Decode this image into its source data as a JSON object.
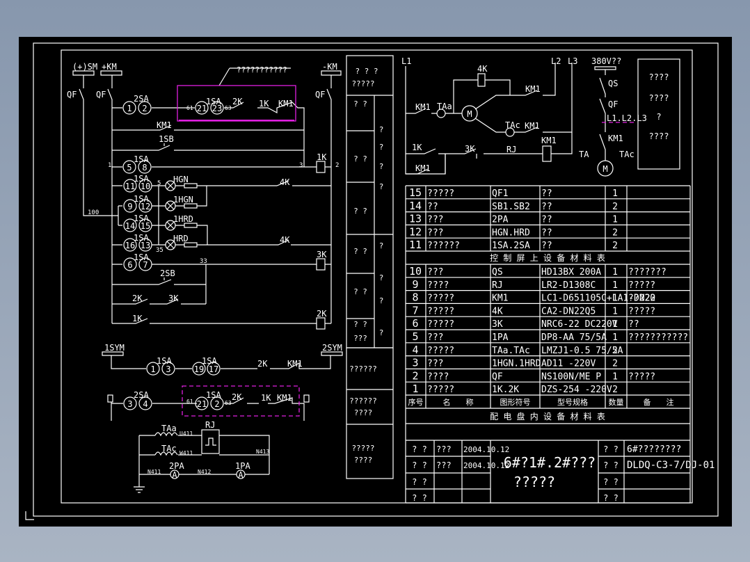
{
  "control": {
    "bus_pos": "(+)SM",
    "bus_km": "+KM",
    "bus_neg": "-KM",
    "qf": "QF",
    "note": "???????????",
    "sa1": "1SA",
    "sa2": "2SA",
    "k1": "1K",
    "k2": "2K",
    "k3": "3K",
    "k4": "4K",
    "km1": "KM1",
    "sb1": "1SB",
    "sb2": "2SB",
    "hgn": "HGN",
    "hgn1": "1HGN",
    "hrd1": "1HRD",
    "hrd": "HRD",
    "n1": "1",
    "n2": "2",
    "n3": "3",
    "n5": "5",
    "n35": "35",
    "n33": "33",
    "n100": "100",
    "n61": "61",
    "n63": "63",
    "terminals": [
      "1",
      "2",
      "21",
      "23",
      "5",
      "8",
      "11",
      "10",
      "9",
      "12",
      "14",
      "15",
      "16",
      "13",
      "6",
      "7"
    ]
  },
  "signal": {
    "sym1": "1SYM",
    "sym2": "2SYM",
    "terminals": [
      "1",
      "3",
      "19",
      "17",
      "3",
      "4",
      "21",
      "2"
    ],
    "taa": "TAa",
    "tac": "TAc",
    "rj": "RJ",
    "pa1": "1PA",
    "pa2": "2PA",
    "u411": "U411",
    "w411": "W411",
    "n411": "N411",
    "n412": "N412",
    "n413": "N413",
    "ammeter": "A"
  },
  "motor": {
    "l1": "L1",
    "l2": "L2",
    "l3": "L3",
    "km1": "KM1",
    "taa": "TAa",
    "tac": "TAc",
    "k4": "4K",
    "k1": "1K",
    "k3": "3K",
    "rj": "RJ",
    "motor": "M",
    "supply": "380V??",
    "qs": "QS",
    "qf": "QF",
    "phases": "L1.L2.L3",
    "ta": "TA",
    "legend": [
      "????",
      "????",
      "?",
      "????"
    ]
  },
  "side_column": {
    "header": [
      "? ? ?",
      "?????"
    ],
    "cells": [
      "? ?",
      "? ?",
      "? ?",
      "? ?",
      "? ?",
      "? ?",
      "? ?",
      "???"
    ],
    "right": [
      "?",
      "?",
      "?",
      "?",
      "?",
      "?",
      "?",
      "?"
    ],
    "lower": [
      "??????",
      "??????",
      "????",
      "?????",
      "????"
    ]
  },
  "control_table": {
    "rows": [
      [
        "15",
        "?????",
        "QF1",
        "??",
        "1",
        ""
      ],
      [
        "14",
        "??",
        "SB1.SB2",
        "??",
        "2",
        ""
      ],
      [
        "13",
        "???",
        "2PA",
        "??",
        "1",
        ""
      ],
      [
        "12",
        "???",
        "HGN.HRD",
        "??",
        "2",
        ""
      ],
      [
        "11",
        "??????",
        "1SA.2SA",
        "??",
        "2",
        ""
      ]
    ],
    "title": "控 制 屏 上 设 备 材 料 表"
  },
  "dist_table": {
    "rows": [
      [
        "10",
        "???",
        "QS",
        "HD13BX 200A",
        "1",
        "???????"
      ],
      [
        "9",
        "????",
        "RJ",
        "LR2-D1308C",
        "1",
        "?????"
      ],
      [
        "8",
        "?????",
        "KM1",
        "LC1-D651105C+LA1-DN22",
        "1",
        "??220"
      ],
      [
        "7",
        "?????",
        "4K",
        "CA2-DN22Q5",
        "1",
        "?????"
      ],
      [
        "6",
        "?????",
        "3K",
        "NRC6-22 DC220V",
        "1",
        "??"
      ],
      [
        "5",
        "???",
        "1PA",
        "DP8-AA 75/5A",
        "1",
        "???????????"
      ],
      [
        "4",
        "?????",
        "TAa.TAc",
        "LMZJ1-0.5 75/5A",
        "2",
        ""
      ],
      [
        "3",
        "???",
        "1HGN.1HRD",
        "AD11 -220V",
        "2",
        ""
      ],
      [
        "2",
        "????",
        "QF",
        "NS100N/ME P",
        "1",
        "?????"
      ],
      [
        "1",
        "?????",
        "1K.2K",
        "DZS-254 -220V",
        "2",
        ""
      ]
    ],
    "headers": [
      "序号",
      "名　　称",
      "图形符号",
      "型号规格",
      "数量",
      "备　　注"
    ],
    "title": "配 电 盘 内 设 备 材 料 表"
  },
  "title_block": {
    "left_rows": [
      [
        "? ?",
        "???",
        "2004.10.12"
      ],
      [
        "? ?",
        "???",
        "2004.10.12"
      ],
      [
        "? ?",
        "",
        ""
      ],
      [
        "? ?",
        "",
        ""
      ]
    ],
    "project": "6#?1#.2#???",
    "drawing_name": "?????",
    "right_labels": [
      "? ?",
      "? ?",
      "? ?",
      "? ?"
    ],
    "right_values": [
      "6#????????",
      "DLDQ-C3-7/DJ-01",
      "",
      ""
    ]
  }
}
